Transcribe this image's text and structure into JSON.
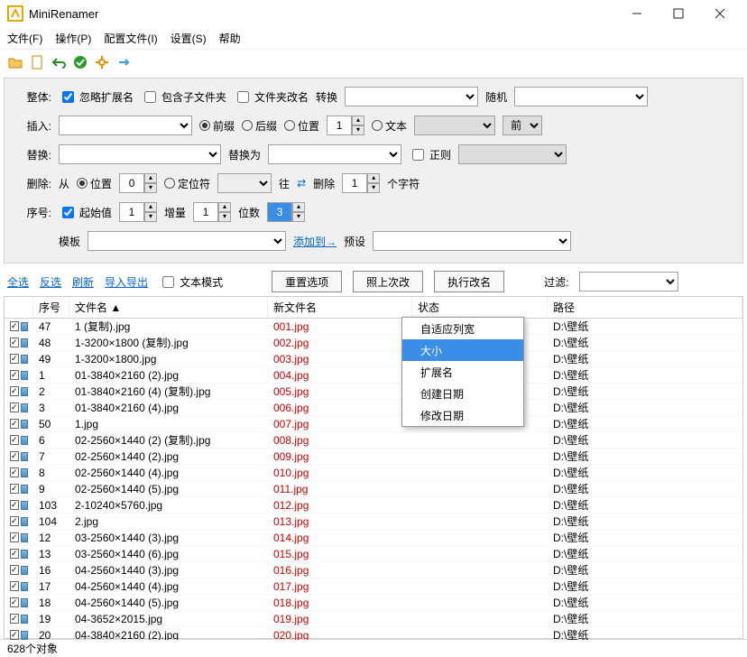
{
  "title": "MiniRenamer",
  "menubar": [
    "文件(F)",
    "操作(P)",
    "配置文件(I)",
    "设置(S)",
    "帮助"
  ],
  "panel": {
    "ztLabel": "整体:",
    "ignoreExt": "忽略扩展名",
    "incSub": "包含子文件夹",
    "renFolder": "文件夹改名",
    "convert": "转换",
    "random": "随机",
    "insLabel": "插入:",
    "prefix": "前缀",
    "suffix": "后缀",
    "pos": "位置",
    "posVal": "1",
    "text": "文本",
    "qian": "前",
    "repLabel": "替换:",
    "toLabel": "替换为",
    "regex": "正则",
    "delLabel": "删除:",
    "from": "从",
    "posR": "位置",
    "posVal2": "0",
    "loc": "定位符",
    "wang": "往",
    "delN": "删除",
    "delVal": "1",
    "chars": "个字符",
    "seqLabel": "序号:",
    "start": "起始值",
    "startVal": "1",
    "inc": "增量",
    "incVal": "1",
    "digits": "位数",
    "digitsVal": "3",
    "tpl": "模板",
    "addTo": "添加到→",
    "preset": "预设"
  },
  "actions": {
    "all": "全选",
    "inv": "反选",
    "ref": "刷新",
    "io": "导入导出",
    "txt": "文本模式",
    "reset": "重置选项",
    "undo": "照上次改",
    "exec": "执行改名",
    "filter": "过滤:"
  },
  "columns": {
    "no": "序号",
    "fn": "文件名 ▲",
    "nn": "新文件名",
    "st": "状态",
    "pt": "路径"
  },
  "context": [
    "自适应列宽",
    "大小",
    "扩展名",
    "创建日期",
    "修改日期"
  ],
  "contextSel": 1,
  "rows": [
    {
      "no": "47",
      "fn": "1 (复制).jpg",
      "nn": "001.jpg",
      "pt": "D:\\壁纸"
    },
    {
      "no": "48",
      "fn": "1-3200×1800 (复制).jpg",
      "nn": "002.jpg",
      "pt": "D:\\壁纸"
    },
    {
      "no": "49",
      "fn": "1-3200×1800.jpg",
      "nn": "003.jpg",
      "pt": "D:\\壁纸"
    },
    {
      "no": "1",
      "fn": "01-3840×2160 (2).jpg",
      "nn": "004.jpg",
      "pt": "D:\\壁纸"
    },
    {
      "no": "2",
      "fn": "01-3840×2160 (4) (复制).jpg",
      "nn": "005.jpg",
      "pt": "D:\\壁纸"
    },
    {
      "no": "3",
      "fn": "01-3840×2160 (4).jpg",
      "nn": "006.jpg",
      "pt": "D:\\壁纸"
    },
    {
      "no": "50",
      "fn": "1.jpg",
      "nn": "007.jpg",
      "pt": "D:\\壁纸"
    },
    {
      "no": "6",
      "fn": "02-2560×1440 (2) (复制).jpg",
      "nn": "008.jpg",
      "pt": "D:\\壁纸"
    },
    {
      "no": "7",
      "fn": "02-2560×1440 (2).jpg",
      "nn": "009.jpg",
      "pt": "D:\\壁纸"
    },
    {
      "no": "8",
      "fn": "02-2560×1440 (4).jpg",
      "nn": "010.jpg",
      "pt": "D:\\壁纸"
    },
    {
      "no": "9",
      "fn": "02-2560×1440 (5).jpg",
      "nn": "011.jpg",
      "pt": "D:\\壁纸"
    },
    {
      "no": "103",
      "fn": "2-10240×5760.jpg",
      "nn": "012.jpg",
      "pt": "D:\\壁纸"
    },
    {
      "no": "104",
      "fn": "2.jpg",
      "nn": "013.jpg",
      "pt": "D:\\壁纸"
    },
    {
      "no": "12",
      "fn": "03-2560×1440 (3).jpg",
      "nn": "014.jpg",
      "pt": "D:\\壁纸"
    },
    {
      "no": "13",
      "fn": "03-2560×1440 (6).jpg",
      "nn": "015.jpg",
      "pt": "D:\\壁纸"
    },
    {
      "no": "16",
      "fn": "04-2560×1440 (3).jpg",
      "nn": "016.jpg",
      "pt": "D:\\壁纸"
    },
    {
      "no": "17",
      "fn": "04-2560×1440 (4).jpg",
      "nn": "017.jpg",
      "pt": "D:\\壁纸"
    },
    {
      "no": "18",
      "fn": "04-2560×1440 (5).jpg",
      "nn": "018.jpg",
      "pt": "D:\\壁纸"
    },
    {
      "no": "19",
      "fn": "04-3652×2015.jpg",
      "nn": "019.jpg",
      "pt": "D:\\壁纸"
    },
    {
      "no": "20",
      "fn": "04-3840×2160 (2).jpg",
      "nn": "020.jpg",
      "pt": "D:\\壁纸"
    }
  ],
  "status": "628个对象"
}
